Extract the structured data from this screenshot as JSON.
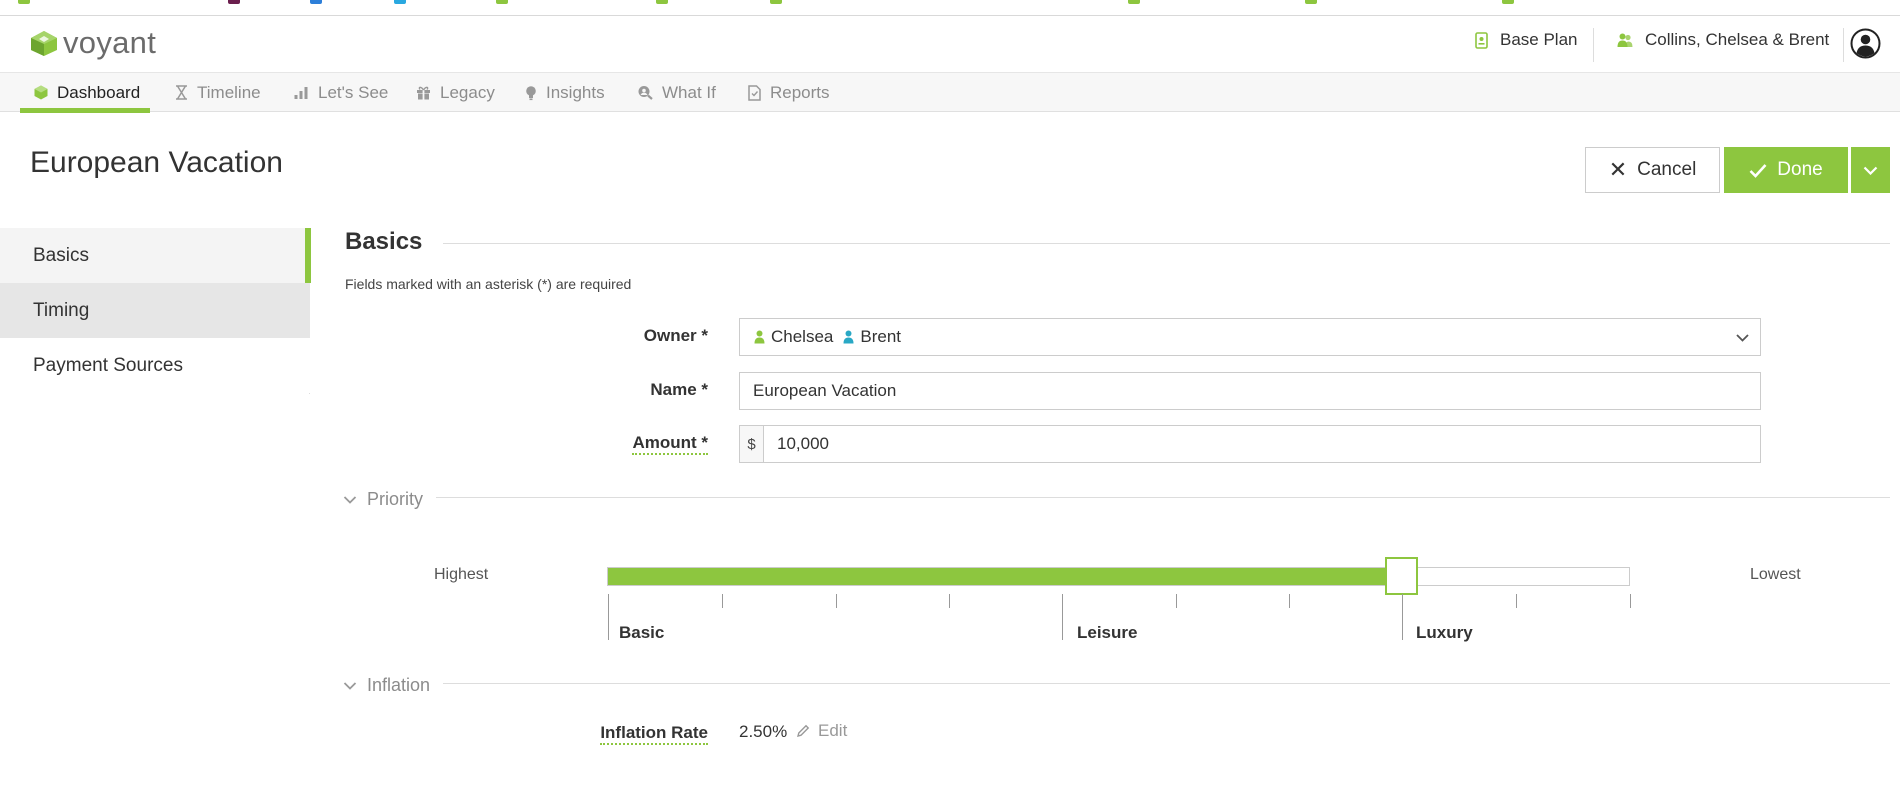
{
  "header": {
    "app_name": "voyant",
    "plan_label": "Base Plan",
    "client_label": "Collins, Chelsea & Brent"
  },
  "nav": {
    "items": [
      {
        "label": "Dashboard",
        "icon": "cube-icon"
      },
      {
        "label": "Timeline",
        "icon": "hourglass-icon"
      },
      {
        "label": "Let's See",
        "icon": "bar-chart-icon"
      },
      {
        "label": "Legacy",
        "icon": "gift-icon"
      },
      {
        "label": "Insights",
        "icon": "lightbulb-icon"
      },
      {
        "label": "What If",
        "icon": "search-people-icon"
      },
      {
        "label": "Reports",
        "icon": "document-icon"
      }
    ],
    "active": "Dashboard"
  },
  "page": {
    "title": "European Vacation",
    "cancel_label": "Cancel",
    "done_label": "Done"
  },
  "side_menu": {
    "items": [
      {
        "label": "Basics"
      },
      {
        "label": "Timing"
      },
      {
        "label": "Payment Sources"
      }
    ],
    "selected": "Basics"
  },
  "form": {
    "section_title": "Basics",
    "required_note": "Fields marked with an asterisk (*) are required",
    "owner": {
      "label": "Owner *",
      "values": [
        "Chelsea",
        "Brent"
      ]
    },
    "name": {
      "label": "Name *",
      "value": "European Vacation"
    },
    "amount": {
      "label": "Amount *",
      "currency": "$",
      "value": "10,000"
    },
    "priority": {
      "header": "Priority",
      "left_label": "Highest",
      "right_label": "Lowest",
      "ticks": [
        "Basic",
        "Leisure",
        "Luxury"
      ],
      "slider_position": 0.777
    },
    "inflation": {
      "header": "Inflation",
      "label": "Inflation Rate",
      "value": "2.50%",
      "edit_label": "Edit"
    }
  },
  "colors": {
    "accent": "#8dc63f",
    "client_icon_green": "#8dc63f",
    "client_icon_blue": "#29a8c5"
  }
}
